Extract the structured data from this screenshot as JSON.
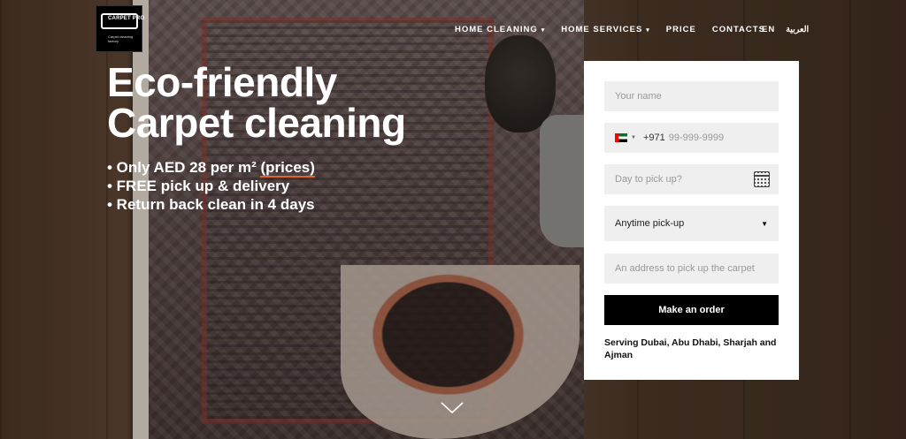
{
  "logo": {
    "name": "CARPET PRO",
    "tagline": "Carpet cleaning factory"
  },
  "nav": {
    "items": [
      {
        "label": "HOME CLEANING",
        "dropdown": true
      },
      {
        "label": "HOME SERVICES",
        "dropdown": true
      },
      {
        "label": "PRICE",
        "dropdown": false
      },
      {
        "label": "CONTACTS",
        "dropdown": false
      }
    ],
    "lang_en": "EN",
    "lang_ar": "العربية"
  },
  "hero": {
    "headline_line1": "Eco-friendly",
    "headline_line2": "Carpet cleaning",
    "bullet1_prefix": "• Only AED 28 per m² ",
    "bullet1_link": "(prices)",
    "bullet2": "• FREE pick up & delivery",
    "bullet3": "• Return back clean in 4 days"
  },
  "form": {
    "name_placeholder": "Your name",
    "phone_code": "+971",
    "phone_placeholder": "99-999-9999",
    "day_placeholder": "Day to pick up?",
    "pickup_selected": "Anytime pick-up",
    "address_placeholder": "An address to pick up the carpet",
    "submit_label": "Make an order",
    "serving_text": "Serving Dubai, Abu Dhabi, Sharjah and Ajman"
  },
  "colors": {
    "accent_underline": "#e0652a",
    "button": "#000000",
    "field_bg": "#efefef"
  }
}
